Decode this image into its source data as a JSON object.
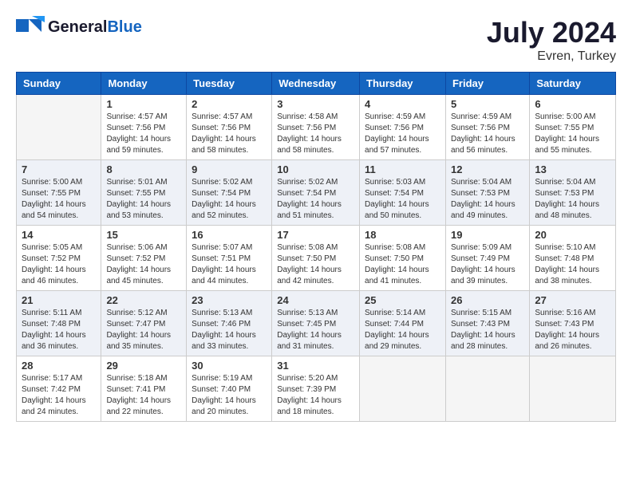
{
  "header": {
    "logo_line1": "General",
    "logo_line2": "Blue",
    "month_year": "July 2024",
    "location": "Evren, Turkey"
  },
  "days_of_week": [
    "Sunday",
    "Monday",
    "Tuesday",
    "Wednesday",
    "Thursday",
    "Friday",
    "Saturday"
  ],
  "weeks": [
    [
      {
        "day": "",
        "info": ""
      },
      {
        "day": "1",
        "info": "Sunrise: 4:57 AM\nSunset: 7:56 PM\nDaylight: 14 hours\nand 59 minutes."
      },
      {
        "day": "2",
        "info": "Sunrise: 4:57 AM\nSunset: 7:56 PM\nDaylight: 14 hours\nand 58 minutes."
      },
      {
        "day": "3",
        "info": "Sunrise: 4:58 AM\nSunset: 7:56 PM\nDaylight: 14 hours\nand 58 minutes."
      },
      {
        "day": "4",
        "info": "Sunrise: 4:59 AM\nSunset: 7:56 PM\nDaylight: 14 hours\nand 57 minutes."
      },
      {
        "day": "5",
        "info": "Sunrise: 4:59 AM\nSunset: 7:56 PM\nDaylight: 14 hours\nand 56 minutes."
      },
      {
        "day": "6",
        "info": "Sunrise: 5:00 AM\nSunset: 7:55 PM\nDaylight: 14 hours\nand 55 minutes."
      }
    ],
    [
      {
        "day": "7",
        "info": "Sunrise: 5:00 AM\nSunset: 7:55 PM\nDaylight: 14 hours\nand 54 minutes."
      },
      {
        "day": "8",
        "info": "Sunrise: 5:01 AM\nSunset: 7:55 PM\nDaylight: 14 hours\nand 53 minutes."
      },
      {
        "day": "9",
        "info": "Sunrise: 5:02 AM\nSunset: 7:54 PM\nDaylight: 14 hours\nand 52 minutes."
      },
      {
        "day": "10",
        "info": "Sunrise: 5:02 AM\nSunset: 7:54 PM\nDaylight: 14 hours\nand 51 minutes."
      },
      {
        "day": "11",
        "info": "Sunrise: 5:03 AM\nSunset: 7:54 PM\nDaylight: 14 hours\nand 50 minutes."
      },
      {
        "day": "12",
        "info": "Sunrise: 5:04 AM\nSunset: 7:53 PM\nDaylight: 14 hours\nand 49 minutes."
      },
      {
        "day": "13",
        "info": "Sunrise: 5:04 AM\nSunset: 7:53 PM\nDaylight: 14 hours\nand 48 minutes."
      }
    ],
    [
      {
        "day": "14",
        "info": "Sunrise: 5:05 AM\nSunset: 7:52 PM\nDaylight: 14 hours\nand 46 minutes."
      },
      {
        "day": "15",
        "info": "Sunrise: 5:06 AM\nSunset: 7:52 PM\nDaylight: 14 hours\nand 45 minutes."
      },
      {
        "day": "16",
        "info": "Sunrise: 5:07 AM\nSunset: 7:51 PM\nDaylight: 14 hours\nand 44 minutes."
      },
      {
        "day": "17",
        "info": "Sunrise: 5:08 AM\nSunset: 7:50 PM\nDaylight: 14 hours\nand 42 minutes."
      },
      {
        "day": "18",
        "info": "Sunrise: 5:08 AM\nSunset: 7:50 PM\nDaylight: 14 hours\nand 41 minutes."
      },
      {
        "day": "19",
        "info": "Sunrise: 5:09 AM\nSunset: 7:49 PM\nDaylight: 14 hours\nand 39 minutes."
      },
      {
        "day": "20",
        "info": "Sunrise: 5:10 AM\nSunset: 7:48 PM\nDaylight: 14 hours\nand 38 minutes."
      }
    ],
    [
      {
        "day": "21",
        "info": "Sunrise: 5:11 AM\nSunset: 7:48 PM\nDaylight: 14 hours\nand 36 minutes."
      },
      {
        "day": "22",
        "info": "Sunrise: 5:12 AM\nSunset: 7:47 PM\nDaylight: 14 hours\nand 35 minutes."
      },
      {
        "day": "23",
        "info": "Sunrise: 5:13 AM\nSunset: 7:46 PM\nDaylight: 14 hours\nand 33 minutes."
      },
      {
        "day": "24",
        "info": "Sunrise: 5:13 AM\nSunset: 7:45 PM\nDaylight: 14 hours\nand 31 minutes."
      },
      {
        "day": "25",
        "info": "Sunrise: 5:14 AM\nSunset: 7:44 PM\nDaylight: 14 hours\nand 29 minutes."
      },
      {
        "day": "26",
        "info": "Sunrise: 5:15 AM\nSunset: 7:43 PM\nDaylight: 14 hours\nand 28 minutes."
      },
      {
        "day": "27",
        "info": "Sunrise: 5:16 AM\nSunset: 7:43 PM\nDaylight: 14 hours\nand 26 minutes."
      }
    ],
    [
      {
        "day": "28",
        "info": "Sunrise: 5:17 AM\nSunset: 7:42 PM\nDaylight: 14 hours\nand 24 minutes."
      },
      {
        "day": "29",
        "info": "Sunrise: 5:18 AM\nSunset: 7:41 PM\nDaylight: 14 hours\nand 22 minutes."
      },
      {
        "day": "30",
        "info": "Sunrise: 5:19 AM\nSunset: 7:40 PM\nDaylight: 14 hours\nand 20 minutes."
      },
      {
        "day": "31",
        "info": "Sunrise: 5:20 AM\nSunset: 7:39 PM\nDaylight: 14 hours\nand 18 minutes."
      },
      {
        "day": "",
        "info": ""
      },
      {
        "day": "",
        "info": ""
      },
      {
        "day": "",
        "info": ""
      }
    ]
  ]
}
